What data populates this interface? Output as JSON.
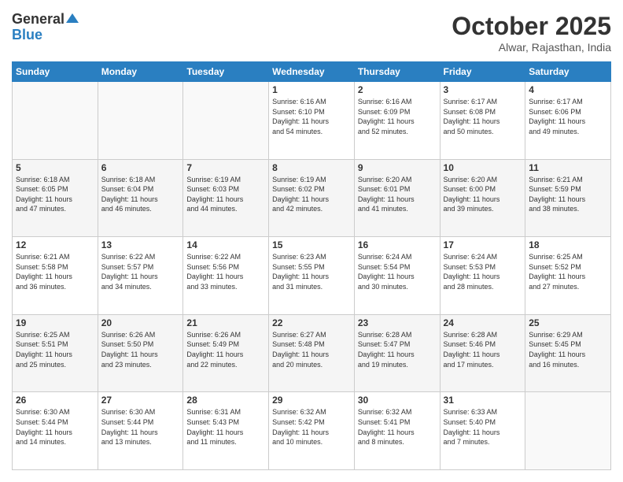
{
  "header": {
    "logo_general": "General",
    "logo_blue": "Blue",
    "month": "October 2025",
    "location": "Alwar, Rajasthan, India"
  },
  "days_of_week": [
    "Sunday",
    "Monday",
    "Tuesday",
    "Wednesday",
    "Thursday",
    "Friday",
    "Saturday"
  ],
  "weeks": [
    [
      {
        "num": "",
        "info": ""
      },
      {
        "num": "",
        "info": ""
      },
      {
        "num": "",
        "info": ""
      },
      {
        "num": "1",
        "info": "Sunrise: 6:16 AM\nSunset: 6:10 PM\nDaylight: 11 hours\nand 54 minutes."
      },
      {
        "num": "2",
        "info": "Sunrise: 6:16 AM\nSunset: 6:09 PM\nDaylight: 11 hours\nand 52 minutes."
      },
      {
        "num": "3",
        "info": "Sunrise: 6:17 AM\nSunset: 6:08 PM\nDaylight: 11 hours\nand 50 minutes."
      },
      {
        "num": "4",
        "info": "Sunrise: 6:17 AM\nSunset: 6:06 PM\nDaylight: 11 hours\nand 49 minutes."
      }
    ],
    [
      {
        "num": "5",
        "info": "Sunrise: 6:18 AM\nSunset: 6:05 PM\nDaylight: 11 hours\nand 47 minutes."
      },
      {
        "num": "6",
        "info": "Sunrise: 6:18 AM\nSunset: 6:04 PM\nDaylight: 11 hours\nand 46 minutes."
      },
      {
        "num": "7",
        "info": "Sunrise: 6:19 AM\nSunset: 6:03 PM\nDaylight: 11 hours\nand 44 minutes."
      },
      {
        "num": "8",
        "info": "Sunrise: 6:19 AM\nSunset: 6:02 PM\nDaylight: 11 hours\nand 42 minutes."
      },
      {
        "num": "9",
        "info": "Sunrise: 6:20 AM\nSunset: 6:01 PM\nDaylight: 11 hours\nand 41 minutes."
      },
      {
        "num": "10",
        "info": "Sunrise: 6:20 AM\nSunset: 6:00 PM\nDaylight: 11 hours\nand 39 minutes."
      },
      {
        "num": "11",
        "info": "Sunrise: 6:21 AM\nSunset: 5:59 PM\nDaylight: 11 hours\nand 38 minutes."
      }
    ],
    [
      {
        "num": "12",
        "info": "Sunrise: 6:21 AM\nSunset: 5:58 PM\nDaylight: 11 hours\nand 36 minutes."
      },
      {
        "num": "13",
        "info": "Sunrise: 6:22 AM\nSunset: 5:57 PM\nDaylight: 11 hours\nand 34 minutes."
      },
      {
        "num": "14",
        "info": "Sunrise: 6:22 AM\nSunset: 5:56 PM\nDaylight: 11 hours\nand 33 minutes."
      },
      {
        "num": "15",
        "info": "Sunrise: 6:23 AM\nSunset: 5:55 PM\nDaylight: 11 hours\nand 31 minutes."
      },
      {
        "num": "16",
        "info": "Sunrise: 6:24 AM\nSunset: 5:54 PM\nDaylight: 11 hours\nand 30 minutes."
      },
      {
        "num": "17",
        "info": "Sunrise: 6:24 AM\nSunset: 5:53 PM\nDaylight: 11 hours\nand 28 minutes."
      },
      {
        "num": "18",
        "info": "Sunrise: 6:25 AM\nSunset: 5:52 PM\nDaylight: 11 hours\nand 27 minutes."
      }
    ],
    [
      {
        "num": "19",
        "info": "Sunrise: 6:25 AM\nSunset: 5:51 PM\nDaylight: 11 hours\nand 25 minutes."
      },
      {
        "num": "20",
        "info": "Sunrise: 6:26 AM\nSunset: 5:50 PM\nDaylight: 11 hours\nand 23 minutes."
      },
      {
        "num": "21",
        "info": "Sunrise: 6:26 AM\nSunset: 5:49 PM\nDaylight: 11 hours\nand 22 minutes."
      },
      {
        "num": "22",
        "info": "Sunrise: 6:27 AM\nSunset: 5:48 PM\nDaylight: 11 hours\nand 20 minutes."
      },
      {
        "num": "23",
        "info": "Sunrise: 6:28 AM\nSunset: 5:47 PM\nDaylight: 11 hours\nand 19 minutes."
      },
      {
        "num": "24",
        "info": "Sunrise: 6:28 AM\nSunset: 5:46 PM\nDaylight: 11 hours\nand 17 minutes."
      },
      {
        "num": "25",
        "info": "Sunrise: 6:29 AM\nSunset: 5:45 PM\nDaylight: 11 hours\nand 16 minutes."
      }
    ],
    [
      {
        "num": "26",
        "info": "Sunrise: 6:30 AM\nSunset: 5:44 PM\nDaylight: 11 hours\nand 14 minutes."
      },
      {
        "num": "27",
        "info": "Sunrise: 6:30 AM\nSunset: 5:44 PM\nDaylight: 11 hours\nand 13 minutes."
      },
      {
        "num": "28",
        "info": "Sunrise: 6:31 AM\nSunset: 5:43 PM\nDaylight: 11 hours\nand 11 minutes."
      },
      {
        "num": "29",
        "info": "Sunrise: 6:32 AM\nSunset: 5:42 PM\nDaylight: 11 hours\nand 10 minutes."
      },
      {
        "num": "30",
        "info": "Sunrise: 6:32 AM\nSunset: 5:41 PM\nDaylight: 11 hours\nand 8 minutes."
      },
      {
        "num": "31",
        "info": "Sunrise: 6:33 AM\nSunset: 5:40 PM\nDaylight: 11 hours\nand 7 minutes."
      },
      {
        "num": "",
        "info": ""
      }
    ]
  ]
}
